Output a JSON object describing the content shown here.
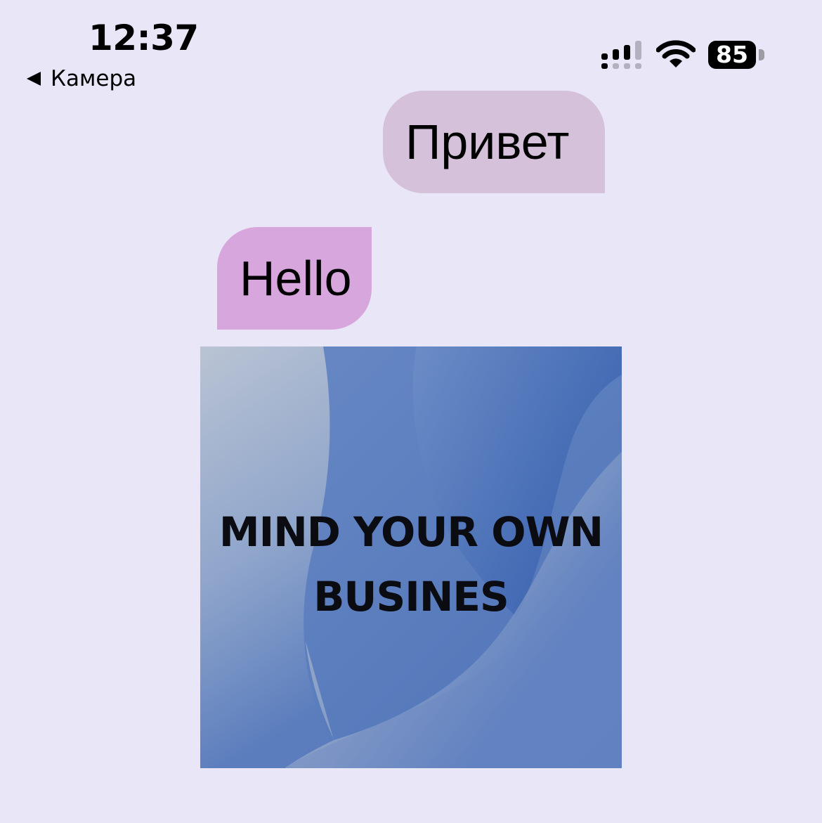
{
  "status_bar": {
    "time": "12:37",
    "back_label": "Камера",
    "battery_level": "85",
    "icons": [
      "back-arrow-icon",
      "signal-bars-icon",
      "wifi-icon",
      "battery-icon"
    ]
  },
  "messages": [
    {
      "direction": "sent",
      "text": "Привет"
    },
    {
      "direction": "received",
      "text": "Hello"
    }
  ],
  "image_message": {
    "caption": "MIND YOUR OWN BUSINES"
  },
  "colors": {
    "background": "#e8e6f7",
    "sent_bubble": "#d5c1da",
    "received_bubble": "#d7a6dc",
    "image_blue": "#3e66b2"
  }
}
